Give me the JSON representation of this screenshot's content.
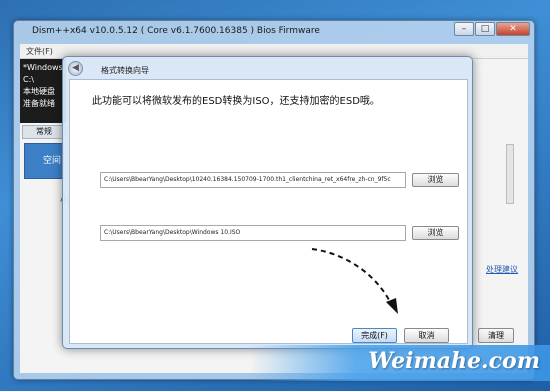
{
  "main_window": {
    "title": "Dism++x64 v10.0.5.12 ( Core v6.1.7600.16385 ) Bios Firmware",
    "menu": "文件(F)",
    "sidebar_lines": [
      "*Windows",
      "C:\\",
      "本地硬盘",
      "准备就绪"
    ],
    "sidebar_tab": "常规",
    "sidebar_button": "空间",
    "small_label": "小",
    "right_link": "处理建议",
    "right_button": "清理",
    "window_buttons": {
      "minimize": "–",
      "maximize": "□",
      "close": "✕"
    }
  },
  "wizard": {
    "title": "格式转换向导",
    "back_icon": "back-arrow-icon",
    "heading": "此功能可以将微软发布的ESD转换为ISO，还支持加密的ESD哦。",
    "source_path": "C:\\Users\\BbearYang\\Desktop\\10240.16384.150709-1700.th1_clientchina_ret_x64fre_zh-cn_9f5c",
    "browse_label_1": "浏览",
    "target_path": "C:\\Users\\BbearYang\\Desktop\\Windows 10.ISO",
    "browse_label_2": "浏览",
    "finish_label": "完成(F)",
    "cancel_label": "取消"
  },
  "watermark": "Weimahe.com"
}
